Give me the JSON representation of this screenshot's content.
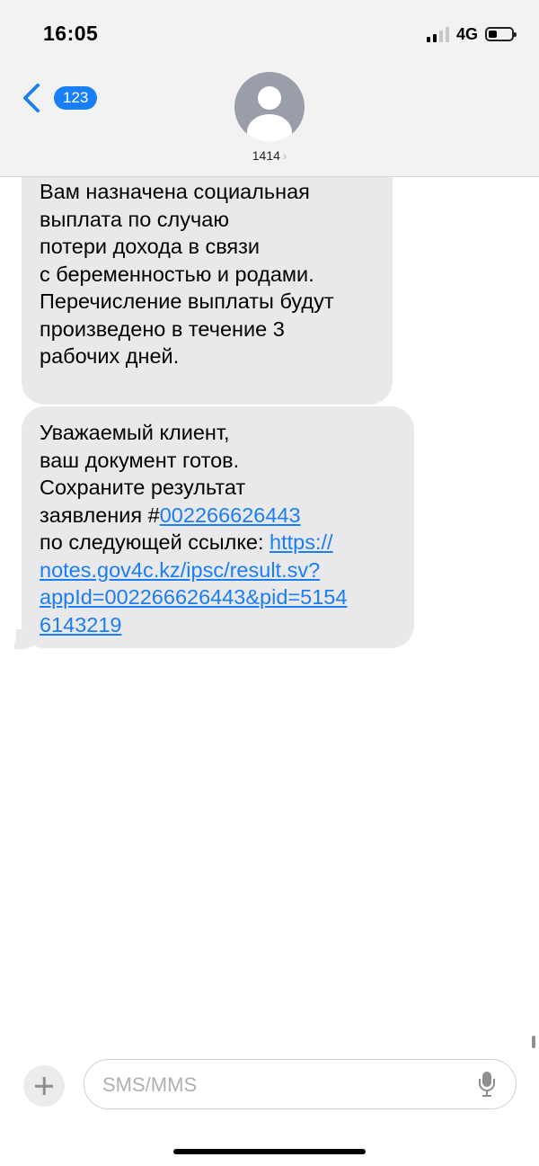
{
  "status_bar": {
    "time": "16:05",
    "network": "4G",
    "signal_bars_active": 2,
    "signal_bars_total": 4,
    "battery_level_fraction": 0.25
  },
  "nav": {
    "back_count": "123",
    "contact_name": "1414",
    "contact_arrow": "›"
  },
  "messages": [
    {
      "lines": [
        "Вам назначена социальная",
        "выплата по случаю",
        "потери дохода в связи",
        "с беременностью и родами.",
        "Перечисление выплаты будут",
        "произведено в течение 3",
        "рабочих дней."
      ]
    },
    {
      "lines": [
        "Уважаемый клиент,",
        "ваш документ готов.",
        "Сохраните результат"
      ],
      "line4_text": "заявления #",
      "line4_link": "002266626443",
      "line5_text": "по следующей ссылке: ",
      "line5_link": "https://",
      "link_lines": [
        "notes.gov4c.kz/ipsc/result.sv?",
        "appId=002266626443&pid=5154",
        "6143219"
      ]
    }
  ],
  "input": {
    "placeholder": "SMS/MMS",
    "value": ""
  },
  "colors": {
    "accent": "#1a7ef5",
    "bubble": "#e9e9eb",
    "header_bg": "#f2f2f2"
  },
  "icons": {
    "back": "chevron-left-icon",
    "avatar": "person-icon",
    "plus": "plus-icon",
    "mic": "microphone-icon"
  }
}
